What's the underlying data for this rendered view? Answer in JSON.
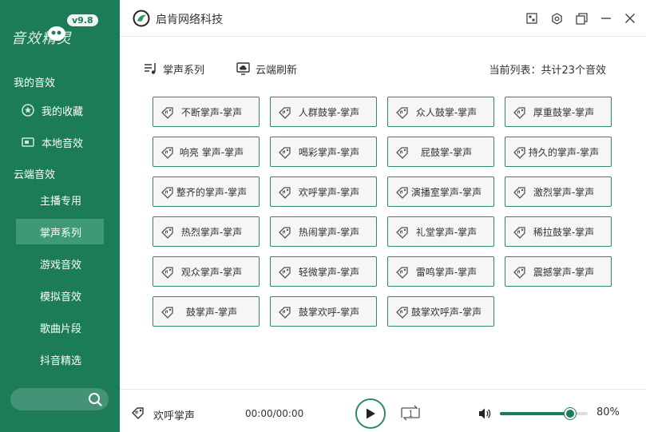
{
  "sidebar": {
    "logo_text": "音效精灵",
    "version": "v9.8",
    "my_section": "我的音效",
    "my_items": [
      {
        "label": "我的收藏",
        "icon": "star-circle-icon"
      },
      {
        "label": "本地音效",
        "icon": "local-folder-icon"
      }
    ],
    "cloud_section": "云端音效",
    "cloud_items": [
      {
        "label": "主播专用"
      },
      {
        "label": "掌声系列",
        "active": true
      },
      {
        "label": "游戏音效"
      },
      {
        "label": "模拟音效"
      },
      {
        "label": "歌曲片段"
      },
      {
        "label": "抖音精选"
      }
    ],
    "search_placeholder": ""
  },
  "header": {
    "title": "启肯网络科技"
  },
  "toolbar": {
    "category_label": "掌声系列",
    "refresh_label": "云端刷新",
    "list_info": "当前列表：共计23个音效"
  },
  "sounds": [
    "不断掌声-掌声",
    "人群鼓掌-掌声",
    "众人鼓掌-掌声",
    "厚重鼓掌-掌声",
    "响亮 掌声-掌声",
    "喝彩掌声-掌声",
    "屁鼓掌-掌声",
    "持久的掌声-掌声",
    "整齐的掌声-掌声",
    "欢呼掌声-掌声",
    "演播室掌声-掌声",
    "激烈掌声-掌声",
    "热烈掌声-掌声",
    "热闹掌声-掌声",
    "礼堂掌声-掌声",
    "稀拉鼓掌-掌声",
    "观众掌声-掌声",
    "轻微掌声-掌声",
    "雷鸣掌声-掌声",
    "震撼掌声-掌声",
    "鼓掌声-掌声",
    "鼓掌欢呼-掌声",
    "鼓掌欢呼声-掌声"
  ],
  "player": {
    "now_playing": "欢呼掌声",
    "time": "00:00/00:00",
    "loop_badge": "1",
    "volume": 80,
    "volume_label": "80%"
  },
  "colors": {
    "sidebar_bg": "#1c7c58",
    "active_item": "#3d9a74",
    "accent": "#2e8a63"
  }
}
